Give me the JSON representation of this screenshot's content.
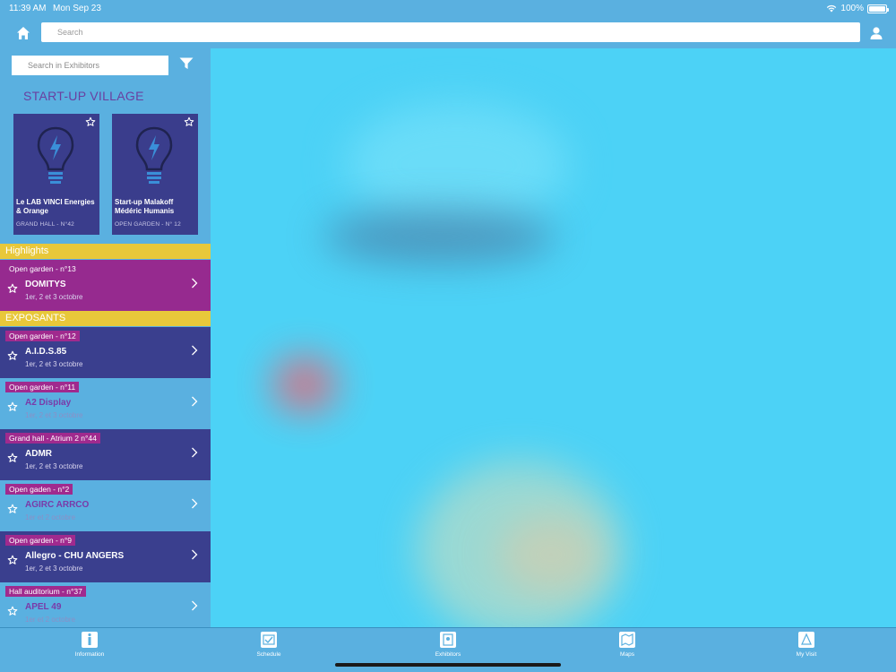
{
  "status": {
    "time": "11:39 AM",
    "date": "Mon Sep 23",
    "battery": "100%",
    "battery_level": 1.0
  },
  "topnav": {
    "search_placeholder": "Search",
    "home_icon": "home-icon",
    "user_icon": "user-icon"
  },
  "sidebar": {
    "search_placeholder": "Search in Exhibitors",
    "filter_icon": "filter-icon",
    "village_title": "START-UP VILLAGE",
    "cards": [
      {
        "name": "Le LAB VINCI Energies & Orange",
        "location": "GRAND HALL - N°42"
      },
      {
        "name": "Start-up Malakoff Médéric Humanis",
        "location": "OPEN GARDEN - N° 12"
      }
    ],
    "highlights_label": "Highlights",
    "highlight": {
      "tag": "Open garden - n°13",
      "title": "DOMITYS",
      "dates": "1er, 2 et 3 octobre"
    },
    "exposants_label": "EXPOSANTS",
    "exhibitors": [
      {
        "tag": "Open garden - n°12",
        "title": "A.I.D.S.85",
        "dates": "1er, 2 et 3 octobre"
      },
      {
        "tag": "Open garden - n°11",
        "title": "A2 Display",
        "dates": "1er, 2 et 3 octobre"
      },
      {
        "tag": "Grand hall - Atrium 2 n°44",
        "title": "ADMR",
        "dates": "1er, 2 et 3 octobre"
      },
      {
        "tag": "Open gaden - n°2",
        "title": "AGIRC ARRCO",
        "dates": "1er et 2 octobre"
      },
      {
        "tag": "Open garden - n°9",
        "title": "Allegro - CHU ANGERS",
        "dates": "1er, 2 et 3 octobre"
      },
      {
        "tag": "Hall auditorium - n°37",
        "title": "APEL 49",
        "dates": "1er et 2 octobre"
      }
    ]
  },
  "tabs": [
    {
      "label": "Information",
      "icon": "information-icon"
    },
    {
      "label": "Schedule",
      "icon": "schedule-icon"
    },
    {
      "label": "Exhibitors",
      "icon": "exhibitors-icon"
    },
    {
      "label": "Maps",
      "icon": "maps-icon"
    },
    {
      "label": "My Visit",
      "icon": "my-visit-icon"
    }
  ],
  "colors": {
    "bar": "#5ab0e0",
    "card": "#3a3d8c",
    "highlight": "#962a8f",
    "section": "#e8c83a",
    "main": "#4cd2f6"
  }
}
